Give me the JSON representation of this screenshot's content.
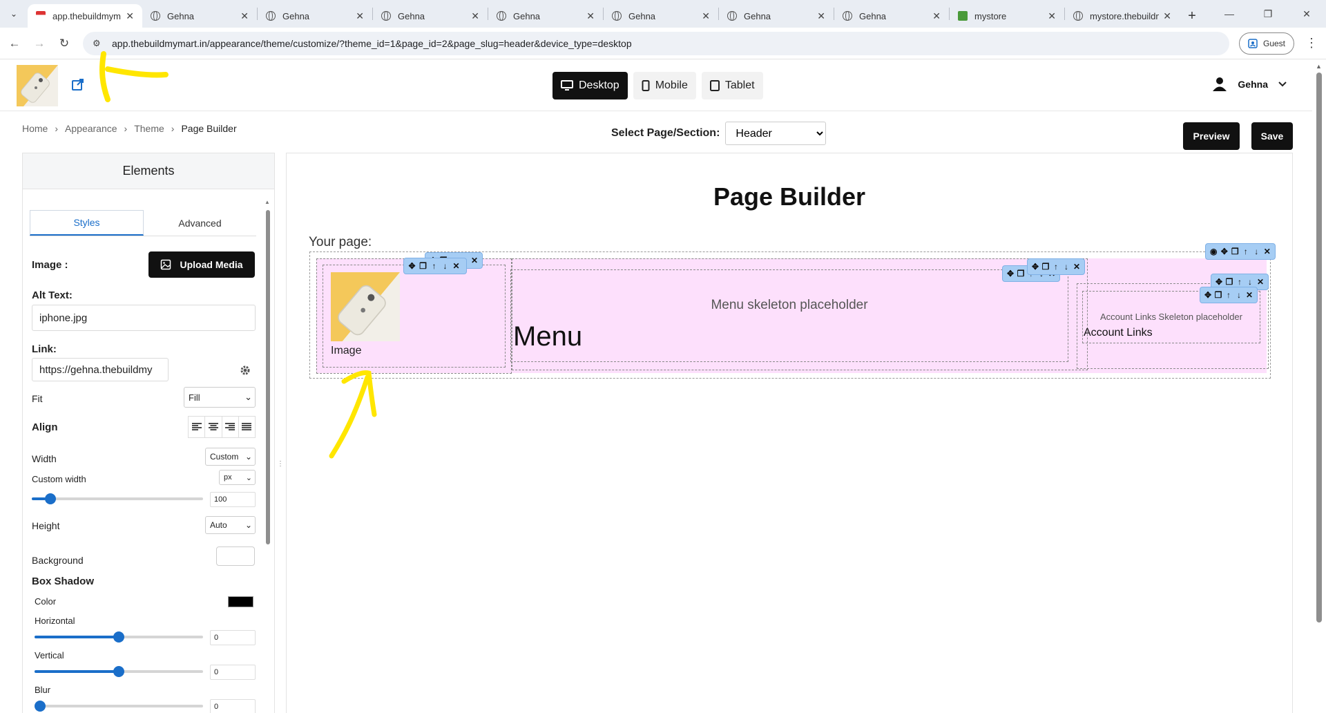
{
  "browser": {
    "tabs": [
      {
        "title": "app.thebuildmym",
        "active": true,
        "icon": "app-favicon"
      },
      {
        "title": "Gehna",
        "icon": "globe-icon"
      },
      {
        "title": "Gehna",
        "icon": "globe-icon"
      },
      {
        "title": "Gehna",
        "icon": "globe-icon"
      },
      {
        "title": "Gehna",
        "icon": "globe-icon"
      },
      {
        "title": "Gehna",
        "icon": "globe-icon"
      },
      {
        "title": "Gehna",
        "icon": "globe-icon"
      },
      {
        "title": "Gehna",
        "icon": "globe-icon"
      },
      {
        "title": "mystore",
        "icon": "store-favicon"
      },
      {
        "title": "mystore.thebuildn",
        "icon": "globe-icon"
      }
    ],
    "url": "app.thebuildmymart.in/appearance/theme/customize/?theme_id=1&page_id=2&page_slug=header&device_type=desktop",
    "profile_label": "Guest"
  },
  "header": {
    "devices": [
      {
        "label": "Desktop",
        "active": true
      },
      {
        "label": "Mobile",
        "active": false
      },
      {
        "label": "Tablet",
        "active": false
      }
    ],
    "user_name": "Gehna"
  },
  "breadcrumb": [
    "Home",
    "Appearance",
    "Theme",
    "Page Builder"
  ],
  "section_select": {
    "label": "Select Page/Section:",
    "value": "Header"
  },
  "actions": {
    "preview": "Preview",
    "save": "Save"
  },
  "elements_panel": {
    "title": "Elements",
    "tabs": [
      "Styles",
      "Advanced"
    ],
    "image_label": "Image :",
    "upload_label": "Upload Media",
    "alt_label": "Alt Text:",
    "alt_value": "iphone.jpg",
    "link_label": "Link:",
    "link_value": "https://gehna.thebuildmy",
    "fit_label": "Fit",
    "fit_value": "Fill",
    "align_label": "Align",
    "width_label": "Width",
    "width_value": "Custom",
    "custom_width_label": "Custom width",
    "custom_width_unit": "px",
    "custom_width_value": "100",
    "custom_width_slider": 0.08,
    "height_label": "Height",
    "height_value": "Auto",
    "background_label": "Background",
    "box_shadow_label": "Box Shadow",
    "color_label": "Color",
    "shadow_color": "#000000",
    "horizontal_label": "Horizontal",
    "horizontal_value": "0",
    "horizontal_slider": 0.5,
    "vertical_label": "Vertical",
    "vertical_value": "0",
    "vertical_slider": 0.5,
    "blur_label": "Blur",
    "blur_value": "0",
    "blur_slider": 0.0
  },
  "canvas": {
    "title": "Page Builder",
    "your_page": "Your page:",
    "image_caption": "Image",
    "menu_placeholder": "Menu skeleton placeholder",
    "menu_label": "Menu",
    "account_placeholder": "Account Links Skeleton placeholder",
    "account_label": "Account Links"
  },
  "colors": {
    "accent": "#1a6ec9",
    "canvas_pink": "#fde0fc",
    "toolbar_blue": "#a6cdf4",
    "annotation_yellow": "#ffe600"
  }
}
